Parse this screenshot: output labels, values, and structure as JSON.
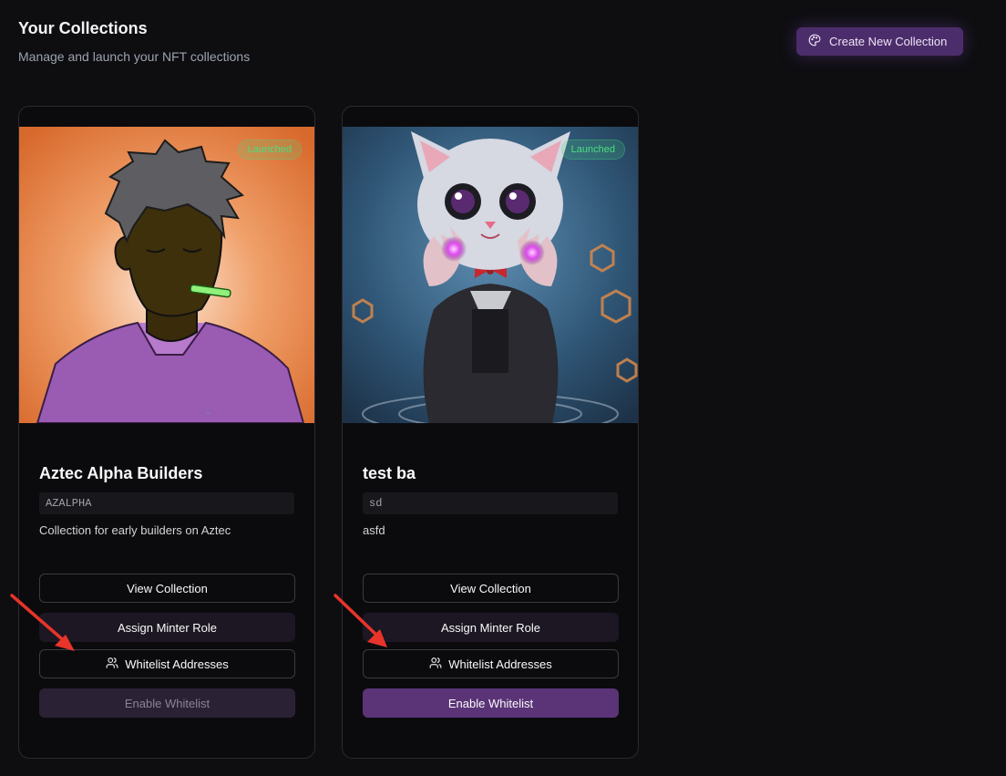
{
  "header": {
    "title": "Your Collections",
    "subtitle": "Manage and launch your NFT collections",
    "create_button": "Create New Collection",
    "create_icon": "palette-icon"
  },
  "colors": {
    "background": "#0e0e11",
    "card": "#0b0b0e",
    "accent": "#5b3478",
    "badge_green": "#4ade80",
    "annotation_arrow": "#e8342a"
  },
  "collections": [
    {
      "image": "portrait of man in purple shirt with orange background",
      "badge": "Launched",
      "title": "Aztec Alpha Builders",
      "symbol": "AZALPHA",
      "description": "Collection for early builders on Aztec",
      "buttons": {
        "view": "View Collection",
        "assign": "Assign Minter Role",
        "whitelist": "Whitelist Addresses",
        "enable": "Enable Whitelist"
      },
      "enable_disabled": true
    },
    {
      "image": "fluffy kitten wizard with glowing purple orbs",
      "badge": "Launched",
      "title": "test ba",
      "symbol": "sd",
      "description": "asfd",
      "buttons": {
        "view": "View Collection",
        "assign": "Assign Minter Role",
        "whitelist": "Whitelist Addresses",
        "enable": "Enable Whitelist"
      },
      "enable_disabled": false
    }
  ]
}
